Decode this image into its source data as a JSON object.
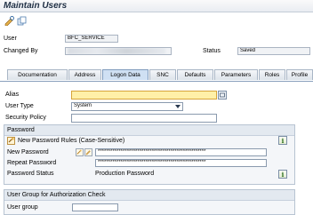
{
  "window": {
    "title": "Maintain Users"
  },
  "toolbar": {
    "icons": [
      "display-change-icon",
      "copy-icon"
    ]
  },
  "header": {
    "user_label": "User",
    "user_value": "BFC_SERVICE",
    "changed_by_label": "Changed By",
    "status_label": "Status",
    "status_value": "Saved"
  },
  "tabs": [
    {
      "label": "Documentation",
      "active": false
    },
    {
      "label": "Address",
      "active": false
    },
    {
      "label": "Logon Data",
      "active": true
    },
    {
      "label": "SNC",
      "active": false
    },
    {
      "label": "Defaults",
      "active": false
    },
    {
      "label": "Parameters",
      "active": false
    },
    {
      "label": "Roles",
      "active": false
    },
    {
      "label": "Profile",
      "active": false
    }
  ],
  "logon": {
    "alias_label": "Alias",
    "alias_value": "",
    "user_type_label": "User Type",
    "user_type_value": "System",
    "security_policy_label": "Security Policy",
    "security_policy_value": ""
  },
  "password_group": {
    "title": "Password",
    "rules_text": "New Password Rules (Case-Sensitive)",
    "new_password_label": "New Password",
    "new_password_value": "****************************************************",
    "repeat_password_label": "Repeat Password",
    "repeat_password_value": "****************************************************",
    "status_label": "Password Status",
    "status_value": "Production Password"
  },
  "user_group": {
    "title": "User Group for Authorization Check",
    "label": "User group",
    "value": ""
  },
  "colors": {
    "alias_highlight": "#fff0a8",
    "active_tab": "#cfe0f3",
    "group_header": "#e3e9f0"
  }
}
